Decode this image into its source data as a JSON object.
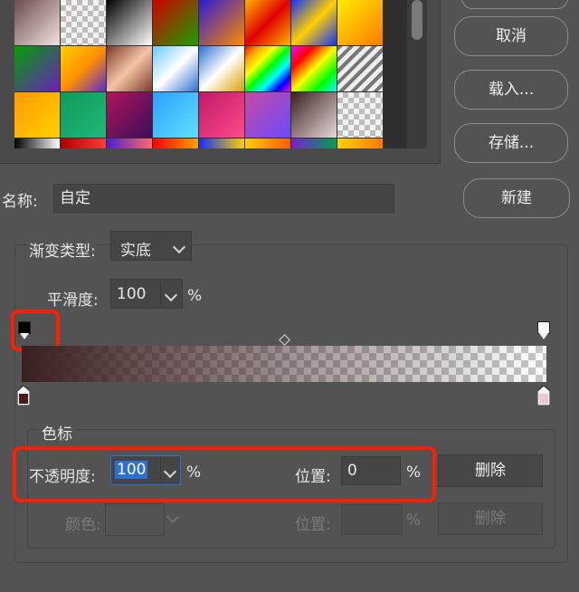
{
  "dialog": {
    "buttons": {
      "cancel": "取消",
      "load": "载入...",
      "save": "存储...",
      "new": "新建"
    },
    "name_label": "名称:",
    "name_value": "自定",
    "gradient_type_label": "渐变类型:",
    "gradient_type_value": "实底",
    "smoothness_label": "平滑度:",
    "smoothness_value": "100",
    "percent": "%",
    "color_stops_title": "色标",
    "opacity_label": "不透明度:",
    "opacity_value": "100",
    "location_label": "位置:",
    "location_value": "0",
    "delete_label": "删除",
    "color_label": "颜色:",
    "location2_label": "位置:",
    "delete2_label": "删除"
  },
  "gradient": {
    "start_color": "#3a1f1f",
    "end_color": "#ecdcdc",
    "opacity_start": 100,
    "opacity_end": 0,
    "color_stop_left": "#4a1c1c",
    "color_stop_right": "#e8cccc"
  },
  "colors": {
    "highlight": "#ff1e00",
    "background": "#535353"
  }
}
